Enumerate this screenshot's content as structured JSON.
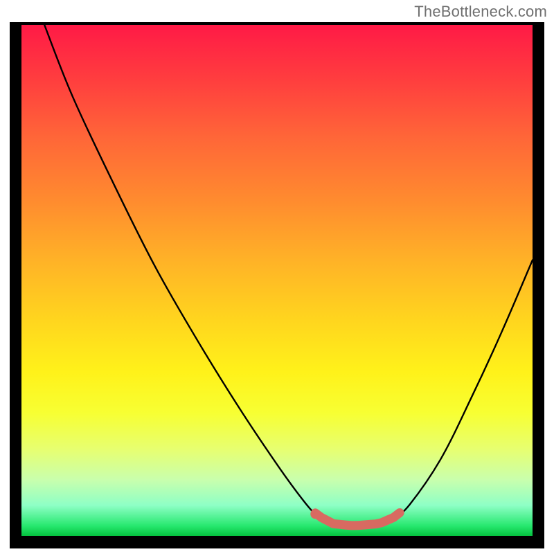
{
  "attribution": "TheBottleneck.com",
  "colors": {
    "frame_bg": "#000000",
    "marker": "#d86a61",
    "curve": "#000000",
    "gradient_top": "#ff1a46",
    "gradient_bottom": "#04c23e"
  },
  "chart_data": {
    "type": "line",
    "title": "",
    "xlabel": "",
    "ylabel": "",
    "xlim": [
      0,
      100
    ],
    "ylim": [
      0,
      100
    ],
    "note": "x/y are percentages of the inner plot area (0..100). y=0 is the top edge (highest bottleneck), y≈98 is the floor (no bottleneck).",
    "series": [
      {
        "name": "bottleneck-curve",
        "points": [
          {
            "x": 4.5,
            "y": 0.0
          },
          {
            "x": 10.0,
            "y": 14.0
          },
          {
            "x": 18.0,
            "y": 31.0
          },
          {
            "x": 26.0,
            "y": 47.0
          },
          {
            "x": 34.0,
            "y": 61.0
          },
          {
            "x": 42.0,
            "y": 74.0
          },
          {
            "x": 50.0,
            "y": 86.0
          },
          {
            "x": 55.5,
            "y": 93.5
          },
          {
            "x": 58.0,
            "y": 96.0
          },
          {
            "x": 61.0,
            "y": 97.6
          },
          {
            "x": 65.0,
            "y": 98.0
          },
          {
            "x": 70.0,
            "y": 97.6
          },
          {
            "x": 73.0,
            "y": 96.3
          },
          {
            "x": 76.0,
            "y": 93.8
          },
          {
            "x": 82.0,
            "y": 85.0
          },
          {
            "x": 88.0,
            "y": 73.0
          },
          {
            "x": 94.0,
            "y": 60.0
          },
          {
            "x": 100.0,
            "y": 46.0
          }
        ]
      }
    ],
    "optimal_range": {
      "x_start": 57.5,
      "x_end": 74.0
    },
    "optimal_point": {
      "x": 57.5,
      "y": 95.7
    }
  }
}
